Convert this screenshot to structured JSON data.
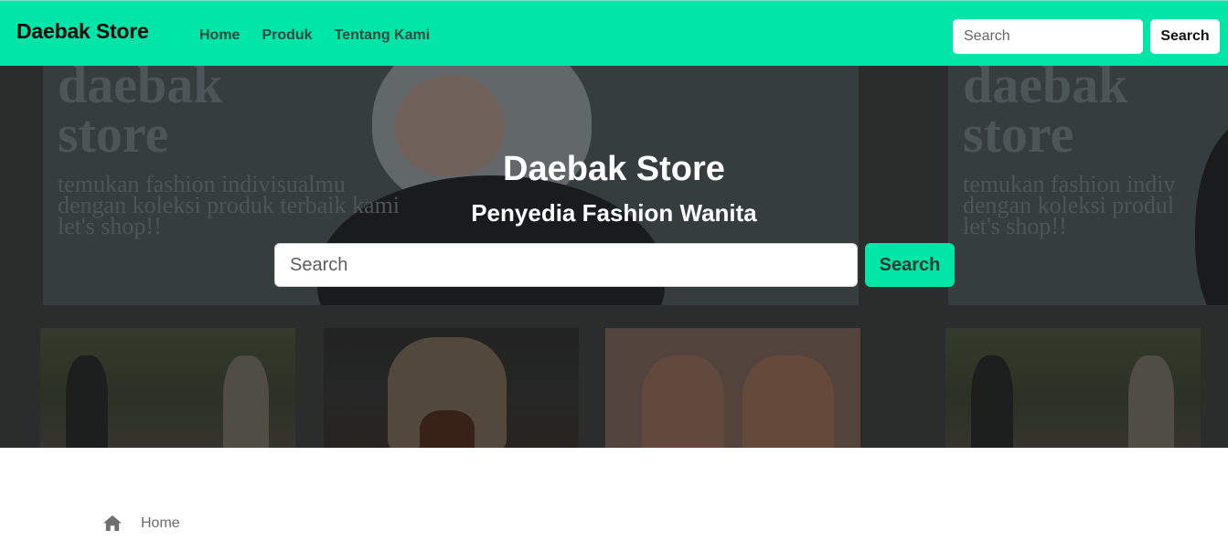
{
  "navbar": {
    "brand": "Daebak Store",
    "links": [
      "Home",
      "Produk",
      "Tentang Kami"
    ],
    "search_placeholder": "Search",
    "search_button": "Search",
    "color": "#00e6a9"
  },
  "hero": {
    "title": "Daebak Store",
    "subtitle": "Penyedia Fashion Wanita",
    "search_placeholder": "Search",
    "search_button": "Search",
    "banner_text": {
      "heading_line1": "daebak",
      "heading_line2": "store",
      "line1": "temukan fashion indivisualmu",
      "line2": "dengan koleksi produk terbaik kami",
      "line3": "let's shop!!"
    },
    "banner_text_right": {
      "heading_line1": "daebak",
      "heading_line2": "store",
      "line1": "temukan fashion indiv",
      "line2": "dengan koleksi produl",
      "line3": "let's shop!!"
    }
  },
  "breadcrumb": {
    "icon": "home-icon",
    "label": "Home"
  }
}
